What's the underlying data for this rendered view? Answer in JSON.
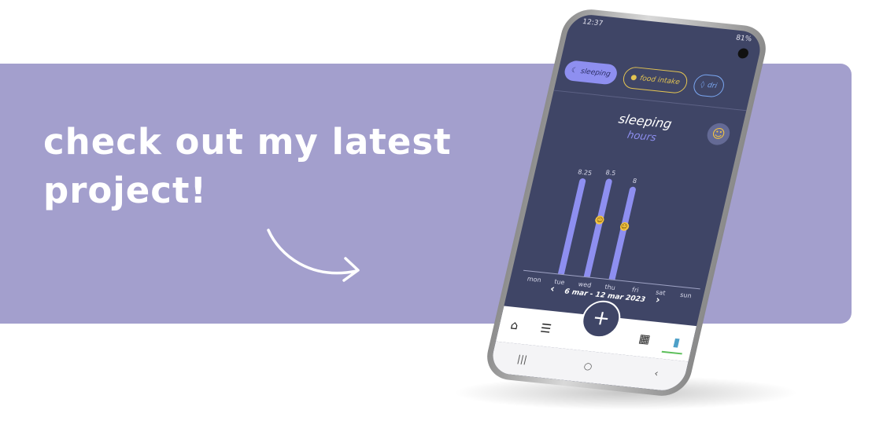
{
  "banner": {
    "headline_line1": "check out my latest",
    "headline_line2": "project!"
  },
  "colors": {
    "banner": "#a39fcd",
    "screen_bg": "#3f4566",
    "accent": "#8e8ff0",
    "food": "#e3c452",
    "drink": "#7aa6f0"
  },
  "phone": {
    "status": {
      "time": "12:37",
      "battery": "81%"
    },
    "chips": [
      {
        "label": "sleeping",
        "icon": "moon-icon"
      },
      {
        "label": "food intake",
        "icon": "food-icon"
      },
      {
        "label": "dri",
        "icon": "drop-icon"
      }
    ],
    "title": "sleeping",
    "subtitle": "hours",
    "range": {
      "label": "6 mar -  12 mar 2023",
      "prev": "‹",
      "next": "›"
    },
    "nav": {
      "add": "+"
    }
  },
  "chart_data": {
    "type": "bar",
    "categories": [
      "mon",
      "tue",
      "wed",
      "thu",
      "fri",
      "sat",
      "sun"
    ],
    "values": [
      null,
      8.25,
      8.5,
      8,
      null,
      null,
      null
    ],
    "value_labels": [
      "",
      "8.25",
      "8.5",
      "8",
      "",
      "",
      ""
    ],
    "mood_markers": [
      false,
      false,
      true,
      true,
      false,
      false,
      false
    ],
    "ylim": [
      0,
      10
    ]
  }
}
